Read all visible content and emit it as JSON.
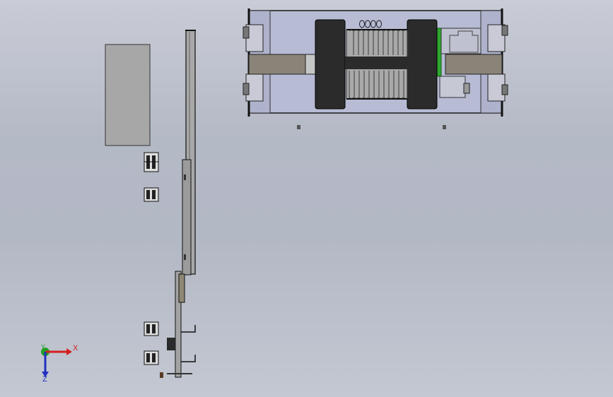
{
  "viewport": {
    "background_top": "#c9ccd6",
    "background_bottom": "#c3c8d2",
    "colors": {
      "frame_blue": "#b9bdd6",
      "frame_edge": "#1a1a1a",
      "shaft": "#8a8378",
      "shaft_light": "#b6b0a6",
      "tire": "#2b2b2b",
      "drum": "#a8a8a8",
      "plate": "#a6a6a6",
      "gear_green": "#2ea82e"
    }
  },
  "triad": {
    "x_label": "X",
    "y_label": "Y",
    "z_label": "Z",
    "x_color": "#d42020",
    "y_color": "#22a022",
    "z_color": "#2030c0"
  }
}
